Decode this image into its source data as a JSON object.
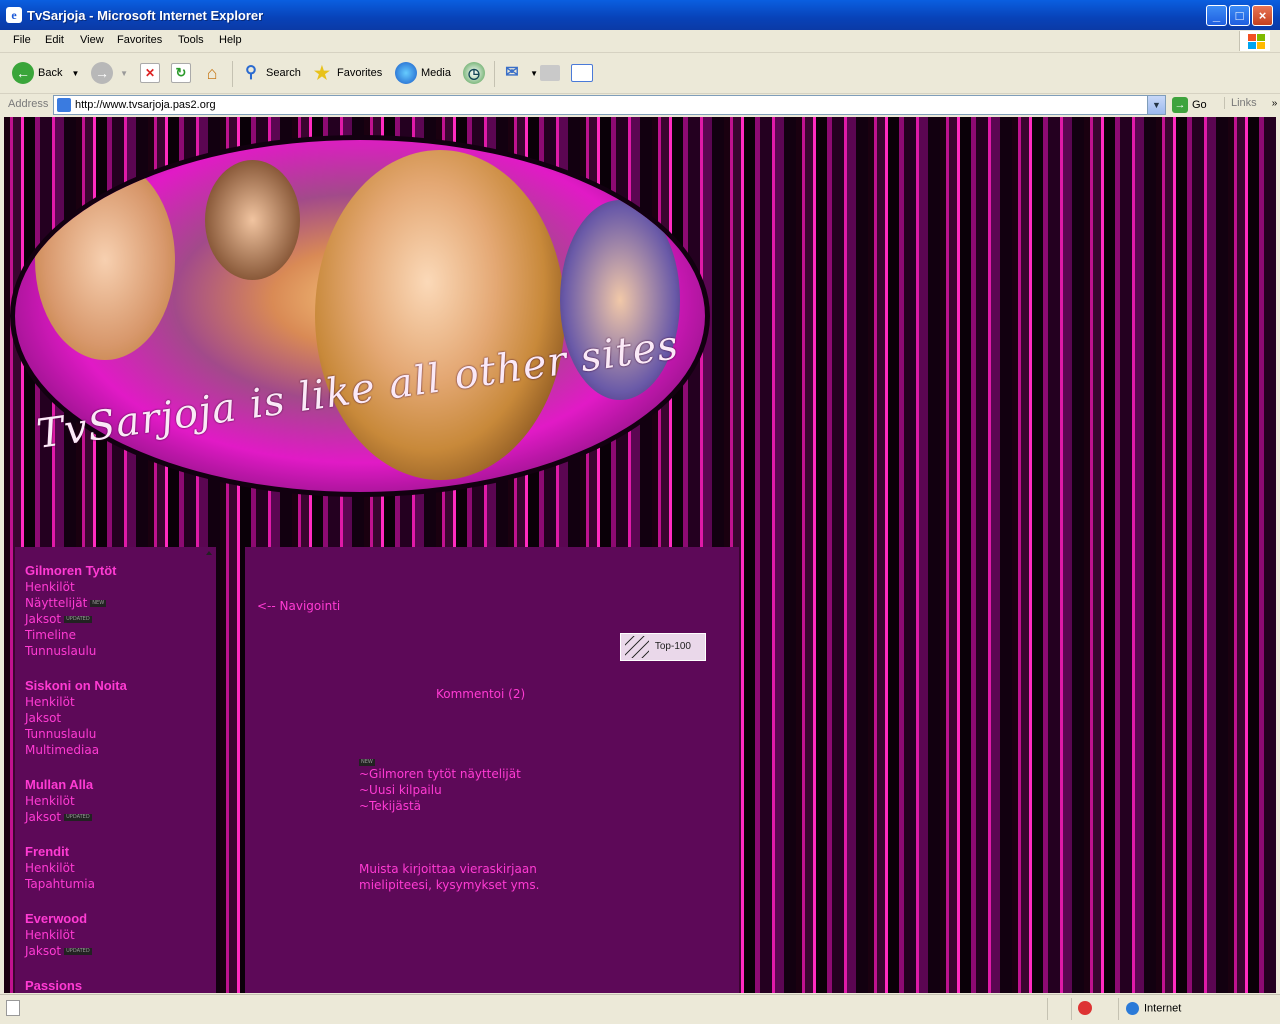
{
  "window": {
    "title": "TvSarjoja - Microsoft Internet Explorer",
    "controls": {
      "minimize": "_",
      "maximize": "□",
      "close": "×"
    }
  },
  "menubar": [
    "File",
    "Edit",
    "View",
    "Favorites",
    "Tools",
    "Help"
  ],
  "toolbar": {
    "back": "Back",
    "search": "Search",
    "favorites": "Favorites",
    "media": "Media"
  },
  "address": {
    "label": "Address",
    "url": "http://www.tvsarjoja.pas2.org",
    "go": "Go",
    "links": "Links"
  },
  "banner": {
    "script_text": "TvSarjoja is like all other sites"
  },
  "sidebar": {
    "sections": [
      {
        "title": "Gilmoren Tytöt",
        "items": [
          {
            "label": "Henkilöt",
            "badge": ""
          },
          {
            "label": "Näyttelijät",
            "badge": "NEW"
          },
          {
            "label": "Jaksot",
            "badge": "UPDATED"
          },
          {
            "label": "Timeline",
            "badge": ""
          },
          {
            "label": "Tunnuslaulu",
            "badge": ""
          }
        ]
      },
      {
        "title": "Siskoni on Noita",
        "items": [
          {
            "label": "Henkilöt",
            "badge": ""
          },
          {
            "label": "Jaksot",
            "badge": ""
          },
          {
            "label": "Tunnuslaulu",
            "badge": ""
          },
          {
            "label": "Multimediaa",
            "badge": ""
          }
        ]
      },
      {
        "title": "Mullan Alla",
        "items": [
          {
            "label": "Henkilöt",
            "badge": ""
          },
          {
            "label": "Jaksot",
            "badge": "UPDATED"
          }
        ]
      },
      {
        "title": "Frendit",
        "items": [
          {
            "label": "Henkilöt",
            "badge": ""
          },
          {
            "label": "Tapahtumia",
            "badge": ""
          }
        ]
      },
      {
        "title": "Everwood",
        "items": [
          {
            "label": "Henkilöt",
            "badge": ""
          },
          {
            "label": "Jaksot",
            "badge": "UPDATED"
          }
        ]
      },
      {
        "title": "Passions",
        "items": []
      }
    ]
  },
  "main": {
    "nav_hint": "<-- Navigointi",
    "top100": "Top-100",
    "comment": "Kommentoi (2)",
    "new_badge": "NEW",
    "news": [
      "~Gilmoren tytöt näyttelijät",
      "~Uusi kilpailu",
      "~Tekijästä"
    ],
    "reminder_line1": "Muista kirjoittaa vieraskirjaan",
    "reminder_line2": "mielipiteesi, kysymykset yms."
  },
  "status": {
    "zone": "Internet"
  }
}
